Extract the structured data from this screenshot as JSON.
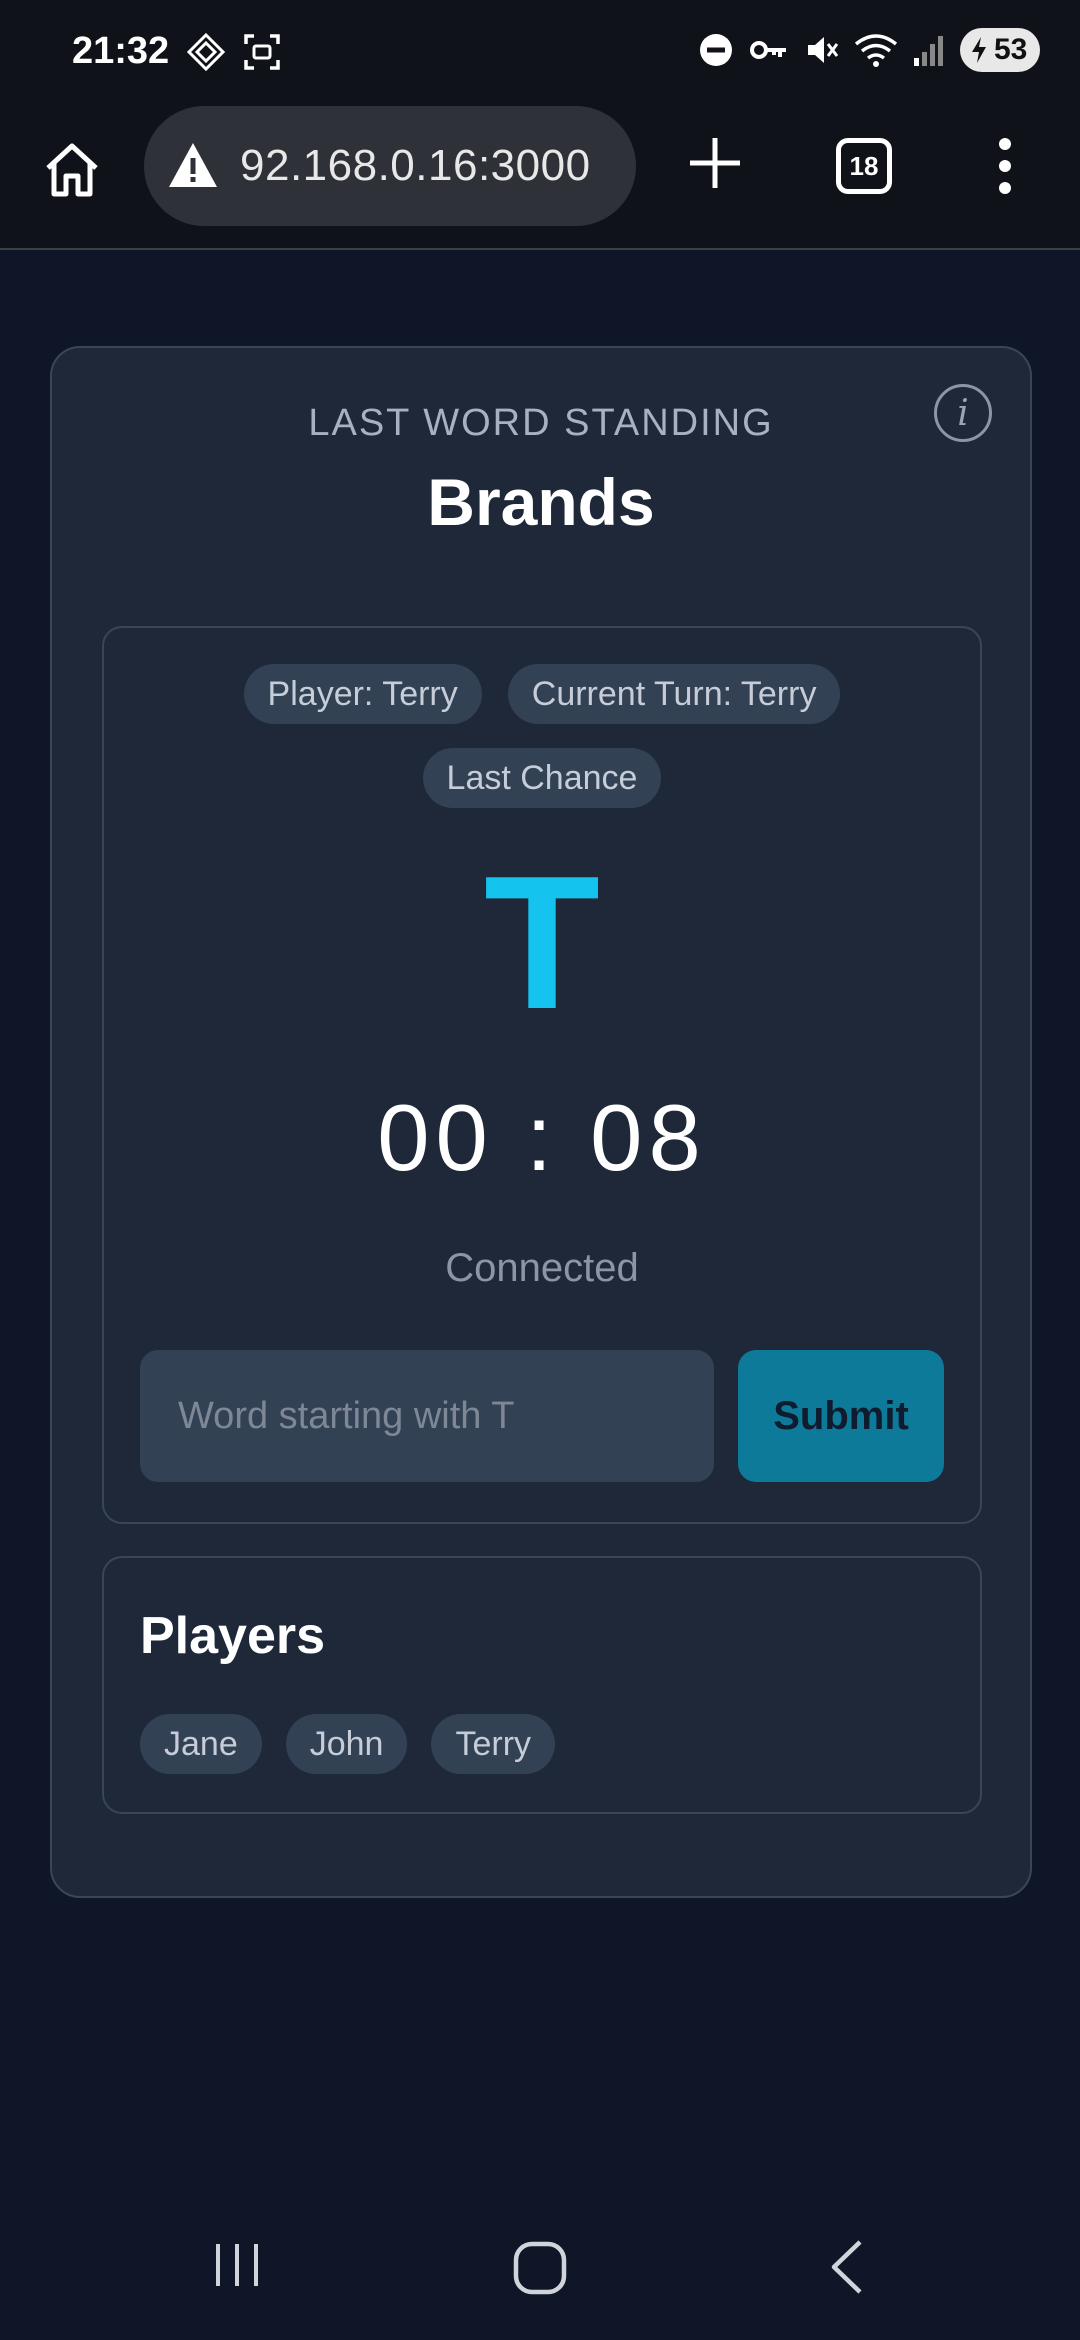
{
  "status_bar": {
    "time": "21:32",
    "battery": "53",
    "left_icons": [
      "diamond-icon",
      "screenshot-icon"
    ],
    "right_icons": [
      "dnd-icon",
      "vpn-key-icon",
      "mute-icon",
      "wifi-icon",
      "signal-icon",
      "battery-icon"
    ]
  },
  "browser": {
    "url": "92.168.0.16:3000",
    "tab_count": "18"
  },
  "game": {
    "title": "LAST WORD STANDING",
    "category": "Brands",
    "info_glyph": "i",
    "badges": {
      "player": "Player: Terry",
      "current_turn": "Current Turn: Terry",
      "last_chance": "Last Chance"
    },
    "letter": "T",
    "timer": "00 : 08",
    "connection": "Connected",
    "input_placeholder": "Word starting with T",
    "submit_label": "Submit",
    "accent_color": "#14c3ee"
  },
  "players": {
    "title": "Players",
    "items": [
      "Jane",
      "John",
      "Terry"
    ]
  }
}
